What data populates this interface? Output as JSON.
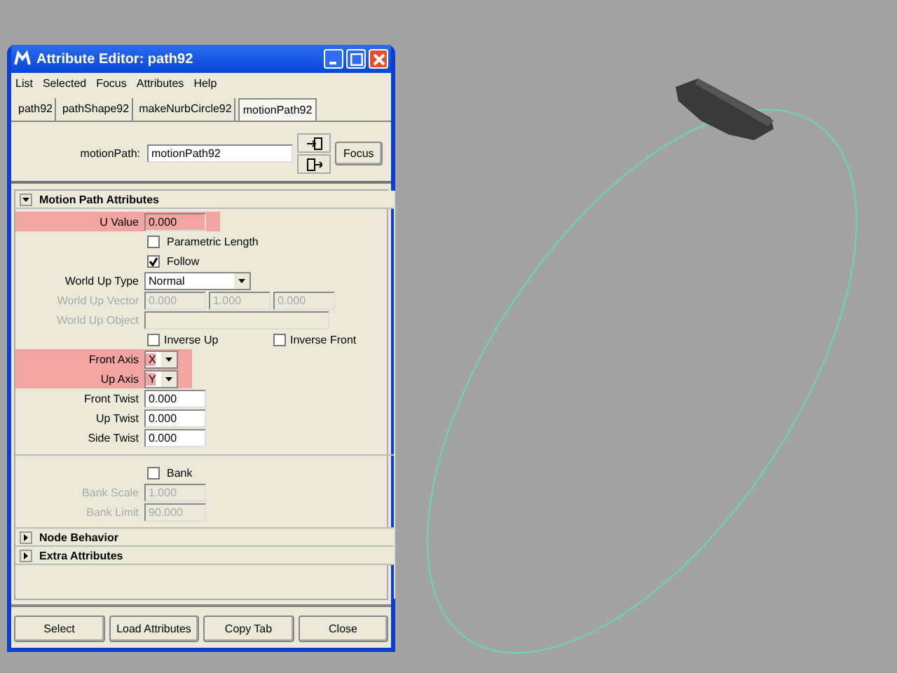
{
  "window": {
    "title": "Attribute Editor: path92"
  },
  "menu": [
    "List",
    "Selected",
    "Focus",
    "Attributes",
    "Help"
  ],
  "tabs": [
    {
      "label": "path92",
      "selected": false
    },
    {
      "label": "pathShape92",
      "selected": false
    },
    {
      "label": "makeNurbCircle92",
      "selected": false
    },
    {
      "label": "motionPath92",
      "selected": true
    }
  ],
  "node": {
    "label": "motionPath:",
    "value": "motionPath92",
    "focus_button": "Focus"
  },
  "sections": [
    {
      "title": "Motion Path Attributes",
      "expanded": true,
      "rows": [
        {
          "kind": "field",
          "label": "U Value",
          "value": "0.000",
          "highlighted": true,
          "disabled": false
        },
        {
          "kind": "checkbox",
          "label": "Parametric Length",
          "checked": false
        },
        {
          "kind": "checkbox",
          "label": "Follow",
          "checked": true
        },
        {
          "kind": "dropdown",
          "label": "World Up Type",
          "value": "Normal",
          "highlighted": false
        },
        {
          "kind": "vector",
          "label": "World Up Vector",
          "values": [
            "0.000",
            "1.000",
            "0.000"
          ],
          "disabled": true
        },
        {
          "kind": "wide",
          "label": "World Up Object",
          "disabled": true
        },
        {
          "kind": "checkpair",
          "items": [
            {
              "label": "Inverse Up",
              "checked": false
            },
            {
              "label": "Inverse Front",
              "checked": false
            }
          ]
        },
        {
          "kind": "axis",
          "label": "Front Axis",
          "value": "X",
          "highlighted": true
        },
        {
          "kind": "axis",
          "label": "Up Axis",
          "value": "Y",
          "highlighted": true
        },
        {
          "kind": "field",
          "label": "Front Twist",
          "value": "0.000",
          "highlighted": false,
          "disabled": false
        },
        {
          "kind": "field",
          "label": "Up Twist",
          "value": "0.000",
          "highlighted": false,
          "disabled": false
        },
        {
          "kind": "field",
          "label": "Side Twist",
          "value": "0.000",
          "highlighted": false,
          "disabled": false
        },
        {
          "kind": "separator"
        },
        {
          "kind": "checkbox",
          "label": "Bank",
          "checked": false
        },
        {
          "kind": "field",
          "label": "Bank Scale",
          "value": "1.000",
          "highlighted": false,
          "disabled": true
        },
        {
          "kind": "field",
          "label": "Bank Limit",
          "value": "90.000",
          "highlighted": false,
          "disabled": true
        }
      ]
    },
    {
      "title": "Node Behavior",
      "expanded": false
    },
    {
      "title": "Extra Attributes",
      "expanded": false
    }
  ],
  "buttons": [
    "Select",
    "Load Attributes",
    "Copy Tab",
    "Close"
  ]
}
